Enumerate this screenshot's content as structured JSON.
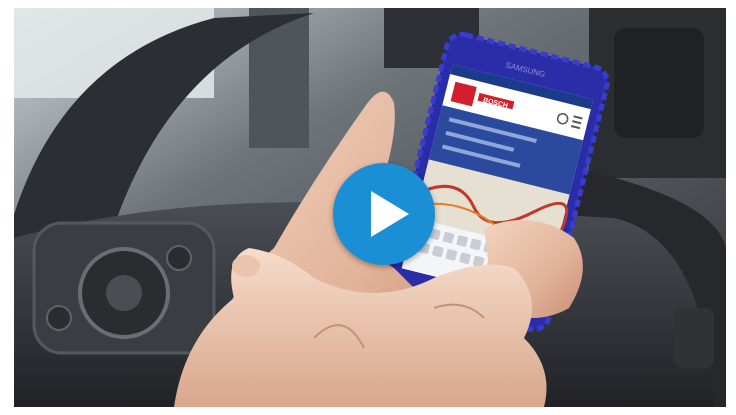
{
  "video": {
    "play_icon": "play-icon",
    "play_color": "#1b8fd6"
  },
  "phone": {
    "brand_text": "SAMSUNG",
    "app_logo_text": "BOSCH"
  }
}
